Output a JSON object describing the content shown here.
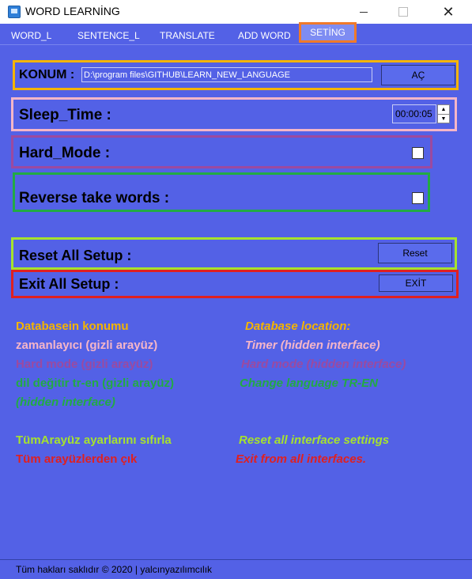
{
  "window": {
    "title": "WORD LEARNİNG"
  },
  "tabs": [
    "WORD_L",
    "SENTENCE_L",
    "TRANSLATE",
    "ADD WORD",
    "SETİNG"
  ],
  "konum": {
    "label": "KONUM :",
    "path_value": "D:\\program files\\GITHUB\\LEARN_NEW_LANGUAGE",
    "button": "AÇ"
  },
  "sleep_time": {
    "label": "Sleep_Time :",
    "value": "00:00:05"
  },
  "hard_mode": {
    "label": "Hard_Mode :",
    "checked": false
  },
  "reverse": {
    "label": "Reverse take words :",
    "checked": false
  },
  "reset": {
    "label": "Reset All Setup :",
    "button": "Reset"
  },
  "exit": {
    "label": "Exit All Setup :",
    "button": "EXİT"
  },
  "notes": {
    "left": [
      "Databasein konumu",
      "zamanlayıcı (gizli arayüz)",
      "Hard mode (gizli arayüz)",
      "dil değitir tr-en (gizli arayüz)",
      "(hidden interface)",
      "TümArayüz ayarlarını sıfırla",
      "Tüm arayüzlerden çık"
    ],
    "right": [
      "Database location:",
      "Timer (hidden interface)",
      "Hard mode (hidden interface)",
      "Change language TR-EN",
      "Reset all interface settings",
      "Exit from all interfaces."
    ]
  },
  "footer": "Tüm hakları saklıdır © 2020 | yalcınyazılımcılık",
  "colors": {
    "background": "#5361e6",
    "frame_konum": "#f4b400",
    "frame_sleep": "#f5b6c8",
    "frame_hard": "#9b4aa0",
    "frame_reverse": "#22aa44",
    "frame_reset": "#a6e22e",
    "frame_exit": "#e02020",
    "active_tab_border": "#f07a2a"
  }
}
